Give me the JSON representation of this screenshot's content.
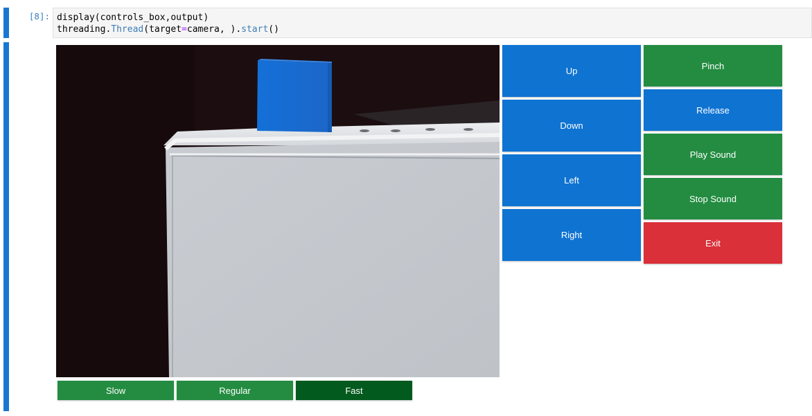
{
  "cell_in": {
    "prompt": "[8]:",
    "code_line_1": {
      "a": "display(controls_box,output)"
    },
    "code_line_2": {
      "a": "threading.",
      "b": "Thread",
      "c": "(target",
      "d": "=",
      "e": "camera, ).",
      "f": "start",
      "g": "()"
    }
  },
  "output": {
    "direction_buttons": [
      "Up",
      "Down",
      "Left",
      "Right"
    ],
    "action_buttons": {
      "pinch": "Pinch",
      "release": "Release",
      "play_sound": "Play Sound",
      "stop_sound": "Stop Sound",
      "exit": "Exit"
    },
    "speed_buttons": [
      "Slow",
      "Regular",
      "Fast"
    ],
    "selected_speed": "Fast"
  },
  "colors": {
    "primary": "#0f73d2",
    "success": "#238c41",
    "danger": "#d9303a",
    "selected": "#035a1e",
    "cell_bar": "#1976d2"
  }
}
